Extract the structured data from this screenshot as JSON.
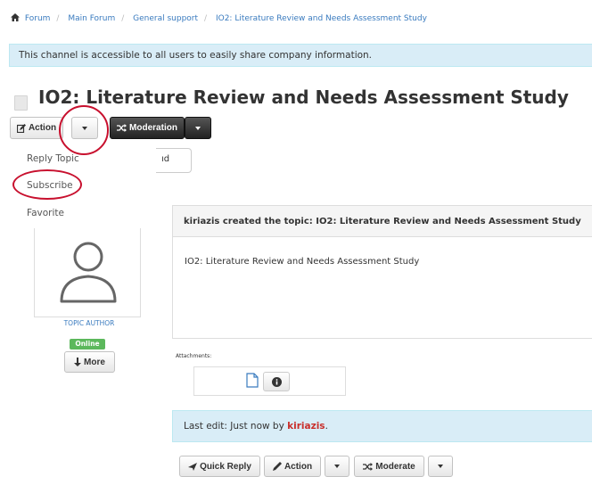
{
  "breadcrumb": [
    "Forum",
    "Main Forum",
    "General support",
    "IO2: Literature Review and Needs Assessment Study"
  ],
  "alert": "This channel is accessible to all users to easily share company information.",
  "page_title": "IO2: Literature Review and Needs Assessment Study",
  "toolbar": {
    "action_label": "Action",
    "moderation_label": "Moderation"
  },
  "dropdown_menu": [
    "Reply Topic",
    "Subscribe",
    "Favorite"
  ],
  "partial_button_label": "ıd",
  "author": {
    "role_label": "TOPIC AUTHOR",
    "status": "Online",
    "more_label": "More"
  },
  "post": {
    "header": "kiriazis created the topic: IO2: Literature Review and Needs Assessment Study",
    "body": "IO2: Literature Review and Needs Assessment Study",
    "attachments_label": "Attachments:",
    "last_edit_prefix": "Last edit: Just now by ",
    "last_edit_user": "kiriazis",
    "last_edit_suffix": "."
  },
  "bottom_toolbar": {
    "quick_reply_label": "Quick Reply",
    "action_label": "Action",
    "moderate_label": "Moderate"
  },
  "colors": {
    "link": "#3a7bbf",
    "info_bg": "#d9edf7",
    "annotation_red": "#c8102e",
    "online_green": "#5cb85c"
  },
  "icons": [
    "home-icon",
    "edit-icon",
    "shuffle-icon",
    "arrow-down-icon",
    "file-icon",
    "info-icon",
    "reply-icon",
    "pencil-icon",
    "user-avatar-icon"
  ]
}
